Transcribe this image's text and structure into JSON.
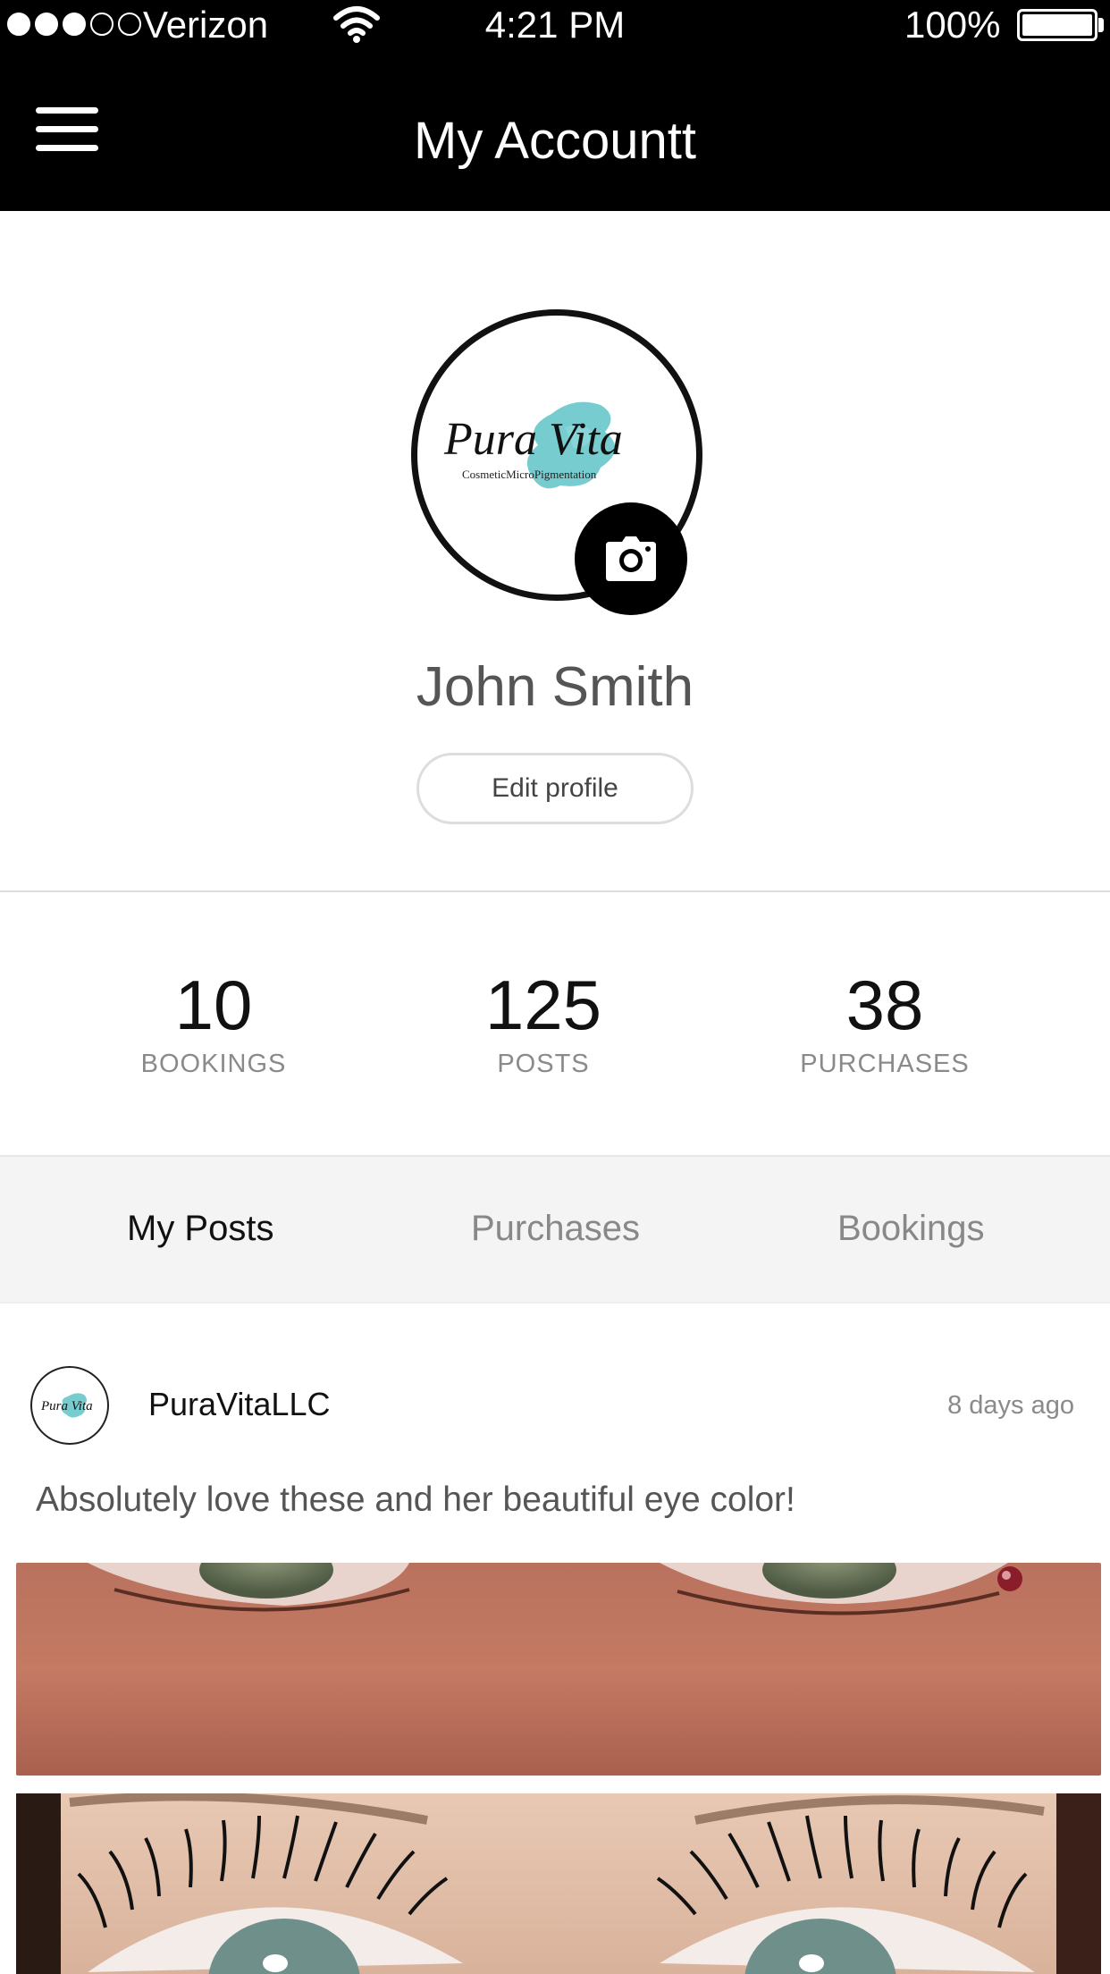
{
  "status_bar": {
    "carrier": "Verizon",
    "time": "4:21 PM",
    "battery": "100%",
    "signal_bars_filled": 3,
    "signal_bars_total": 5
  },
  "header": {
    "title": "My Accountt",
    "menu_icon": "hamburger-menu-icon"
  },
  "profile": {
    "logo_text": "Pura Vita",
    "logo_subtext": "CosmeticMicroPigmentation",
    "name": "John Smith",
    "edit_button": "Edit profile",
    "camera_icon": "camera-icon"
  },
  "stats": [
    {
      "value": "10",
      "label": "BOOKINGS"
    },
    {
      "value": "125",
      "label": "POSTS"
    },
    {
      "value": "38",
      "label": "PURCHASES"
    }
  ],
  "tabs": [
    {
      "label": "My Posts",
      "active": true
    },
    {
      "label": "Purchases",
      "active": false
    },
    {
      "label": "Bookings",
      "active": false
    }
  ],
  "post": {
    "author": "PuraVitaLLC",
    "time": "8 days ago",
    "text": "Absolutely love these and her beautiful eye color!"
  },
  "colors": {
    "header_bg": "#000000",
    "logo_accent": "#5ec3c7",
    "tab_bar_bg": "#f4f4f4",
    "muted_text": "#8a8a8a"
  }
}
